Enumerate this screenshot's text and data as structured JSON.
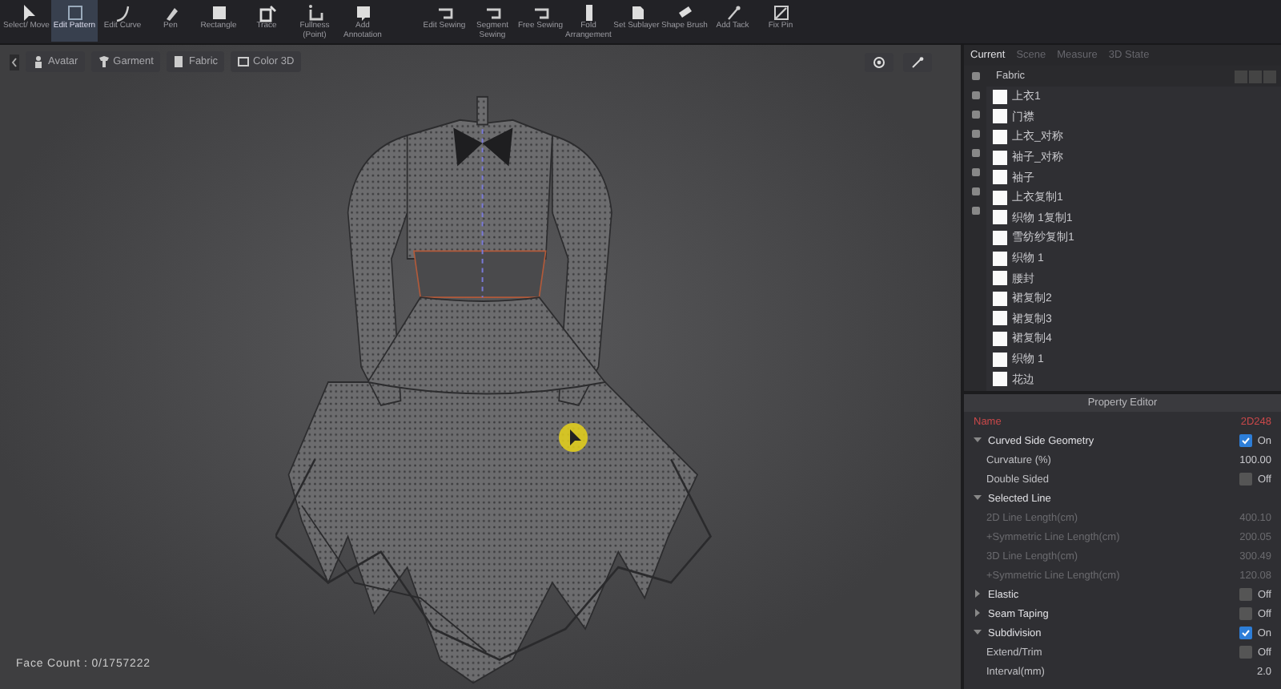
{
  "toolbar": {
    "tools": [
      {
        "label": "Select/ Move",
        "kind": "pointer",
        "selected": false
      },
      {
        "label": "Edit Pattern",
        "kind": "square",
        "selected": true
      },
      {
        "label": "Edit Curve",
        "kind": "curve",
        "selected": false
      },
      {
        "label": "Pen",
        "kind": "pen",
        "selected": false
      },
      {
        "label": "Rectangle",
        "kind": "rect",
        "selected": false
      },
      {
        "label": "Trace",
        "kind": "trace",
        "selected": false
      },
      {
        "label": "Fullness (Point)",
        "kind": "fullness",
        "selected": false
      },
      {
        "label": "Add Annotation",
        "kind": "note",
        "selected": false
      },
      {
        "label": "Edit Sewing",
        "kind": "sew",
        "selected": false
      },
      {
        "label": "Segment Sewing",
        "kind": "sew",
        "selected": false
      },
      {
        "label": "Free Sewing",
        "kind": "sew",
        "selected": false
      },
      {
        "label": "Fold Arrangement",
        "kind": "fold",
        "selected": false
      },
      {
        "label": "Set Sublayer",
        "kind": "layer",
        "selected": false
      },
      {
        "label": "Shape Brush",
        "kind": "brush",
        "selected": false
      },
      {
        "label": "Add Tack",
        "kind": "tack",
        "selected": false
      },
      {
        "label": "Fix Pin",
        "kind": "pin",
        "selected": false
      }
    ]
  },
  "viewport": {
    "toggles": [
      {
        "label": "Avatar",
        "kind": "person"
      },
      {
        "label": "Garment",
        "kind": "shirt"
      },
      {
        "label": "Fabric",
        "kind": "fabric"
      },
      {
        "label": "Color 3D",
        "kind": "color"
      }
    ],
    "face_count": "Face Count : 0/1757222"
  },
  "panel": {
    "tabs": [
      {
        "label": "Current",
        "selected": true
      },
      {
        "label": "Scene",
        "selected": false
      },
      {
        "label": "Measure",
        "selected": false
      },
      {
        "label": "3D State",
        "selected": false
      }
    ],
    "list_title": "Fabric",
    "fabrics": [
      "上衣1",
      "门襟",
      "上衣_对称",
      "袖子_对称",
      "袖子",
      "上衣复制1",
      "织物 1复制1",
      "雪纺纱复制1",
      "织物 1",
      "腰封",
      "裙复制2",
      "裙复制3",
      "裙复制4",
      "织物 1",
      "花边"
    ]
  },
  "property_editor": {
    "title": "Property Editor",
    "rows": [
      {
        "kind": "name",
        "label": "Name",
        "value": "2D248"
      },
      {
        "kind": "section",
        "label": "Curved Side Geometry",
        "expanded": true,
        "on": true,
        "value": "On"
      },
      {
        "kind": "field",
        "label": "Curvature (%)",
        "value": "100.00"
      },
      {
        "kind": "toggle",
        "label": "Double Sided",
        "on": false,
        "value": "Off"
      },
      {
        "kind": "section",
        "label": "Selected Line",
        "expanded": true
      },
      {
        "kind": "readonly",
        "label": "2D Line Length(cm)",
        "value": "400.10"
      },
      {
        "kind": "readonly",
        "label": "+Symmetric Line Length(cm)",
        "value": "200.05"
      },
      {
        "kind": "readonly",
        "label": "3D Line Length(cm)",
        "value": "300.49"
      },
      {
        "kind": "readonly",
        "label": "+Symmetric Line Length(cm)",
        "value": "120.08"
      },
      {
        "kind": "section",
        "label": "Elastic",
        "expanded": false,
        "on": false,
        "value": "Off"
      },
      {
        "kind": "section",
        "label": "Seam Taping",
        "expanded": false,
        "on": false,
        "value": "Off"
      },
      {
        "kind": "section",
        "label": "Subdivision",
        "expanded": true,
        "on": true,
        "value": "On"
      },
      {
        "kind": "toggle",
        "label": "Extend/Trim",
        "on": false,
        "value": "Off"
      },
      {
        "kind": "field",
        "label": "Interval(mm)",
        "value": "2.0"
      }
    ]
  }
}
